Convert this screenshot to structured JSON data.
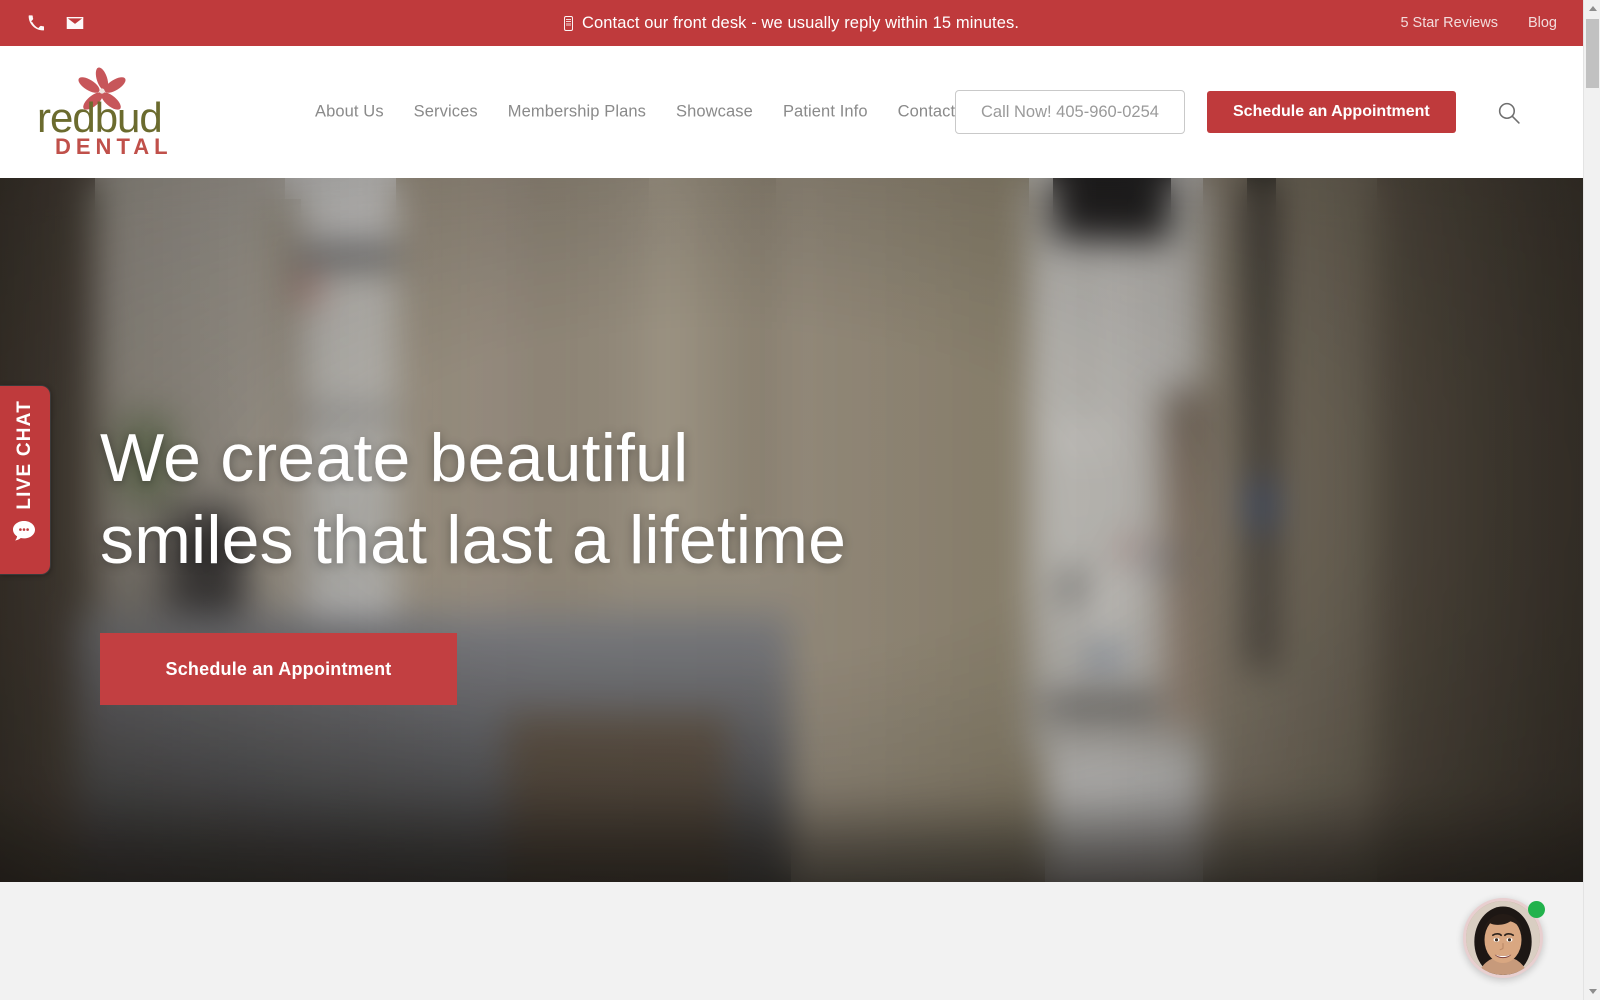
{
  "topbar": {
    "phone_icon": "phone-icon",
    "email_icon": "envelope-icon",
    "message": "Contact our front desk - we usually reply within 15 minutes.",
    "links": [
      {
        "label": "5 Star Reviews"
      },
      {
        "label": "Blog"
      }
    ]
  },
  "brand": {
    "name": "redbud",
    "tagline": "DENTAL",
    "name_color": "#6b6b2e",
    "tagline_color": "#c0504a",
    "flower_color": "#c7565a"
  },
  "nav": {
    "items": [
      {
        "label": "About Us"
      },
      {
        "label": "Services"
      },
      {
        "label": "Membership Plans"
      },
      {
        "label": "Showcase"
      },
      {
        "label": "Patient Info"
      },
      {
        "label": "Contact"
      }
    ]
  },
  "header": {
    "call_button": "Call Now! 405-960-0254",
    "schedule_button": "Schedule an Appointment",
    "search_icon": "search-icon"
  },
  "hero": {
    "title_line1": "We create beautiful",
    "title_line2": "smiles that last a lifetime",
    "cta_label": "Schedule an Appointment"
  },
  "live_chat": {
    "label": "LIVE CHAT",
    "icon": "chat-bubble-icon"
  },
  "chat_widget": {
    "avatar_icon": "agent-avatar",
    "status": "online"
  },
  "colors": {
    "brand_red": "#bf3a3c",
    "hero_cta_red": "#c23f41",
    "nav_text": "#8a8a8a",
    "page_bg": "#f2f2f2",
    "status_green": "#22b24c"
  },
  "scrollbar": {
    "up_arrow": "scroll-up-arrow",
    "down_arrow": "scroll-down-arrow"
  }
}
